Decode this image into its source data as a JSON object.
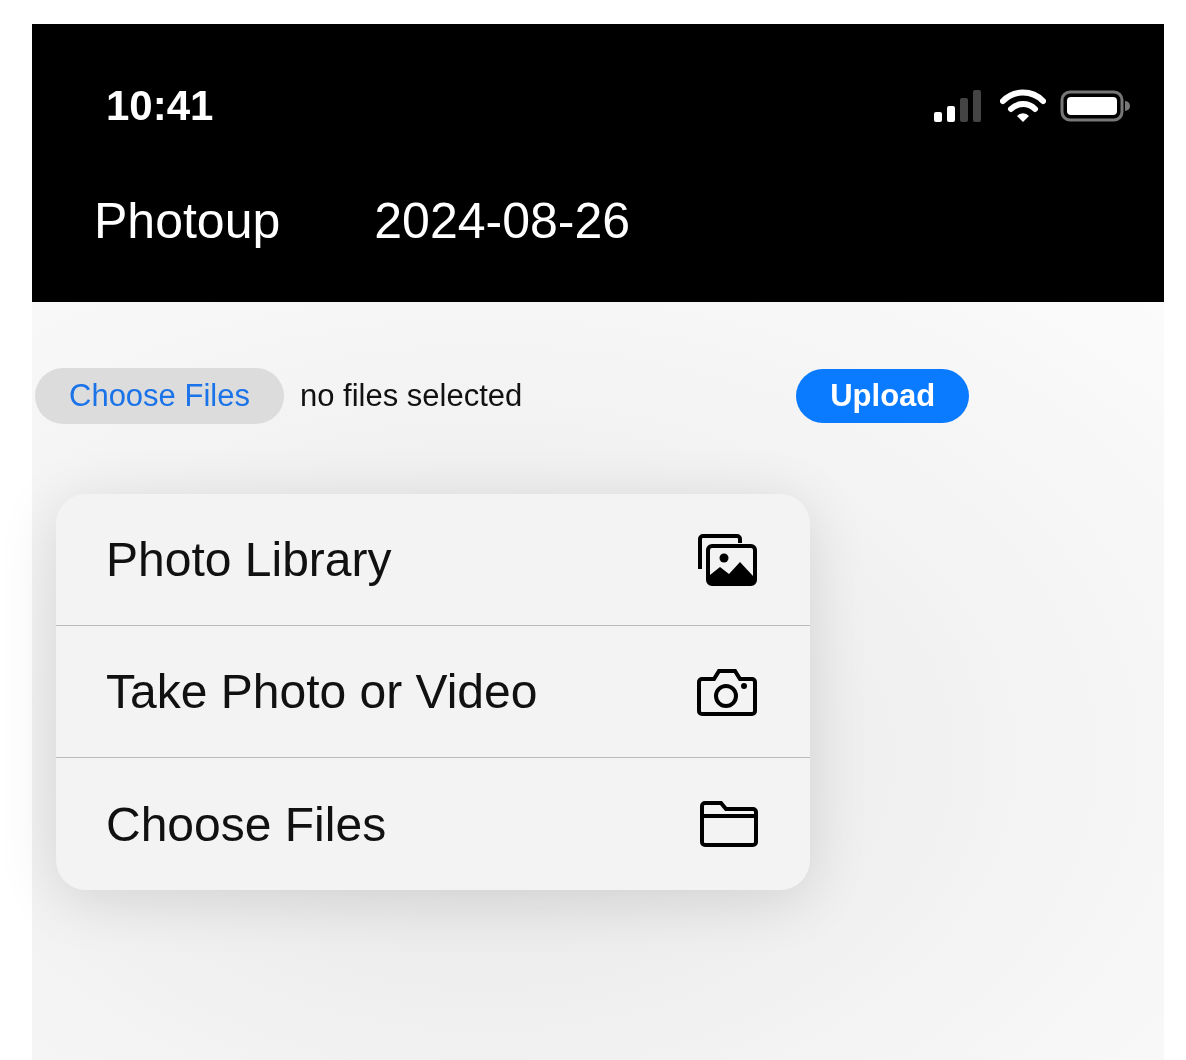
{
  "status_bar": {
    "time": "10:41"
  },
  "header": {
    "title": "Photoup",
    "date": "2024-08-26"
  },
  "file_input": {
    "button": "Choose Files",
    "status": "no files selected"
  },
  "upload_button": "Upload",
  "menu": [
    {
      "label": "Photo Library",
      "kind": "photos"
    },
    {
      "label": "Take Photo or Video",
      "kind": "camera"
    },
    {
      "label": "Choose Files",
      "kind": "folder"
    }
  ]
}
